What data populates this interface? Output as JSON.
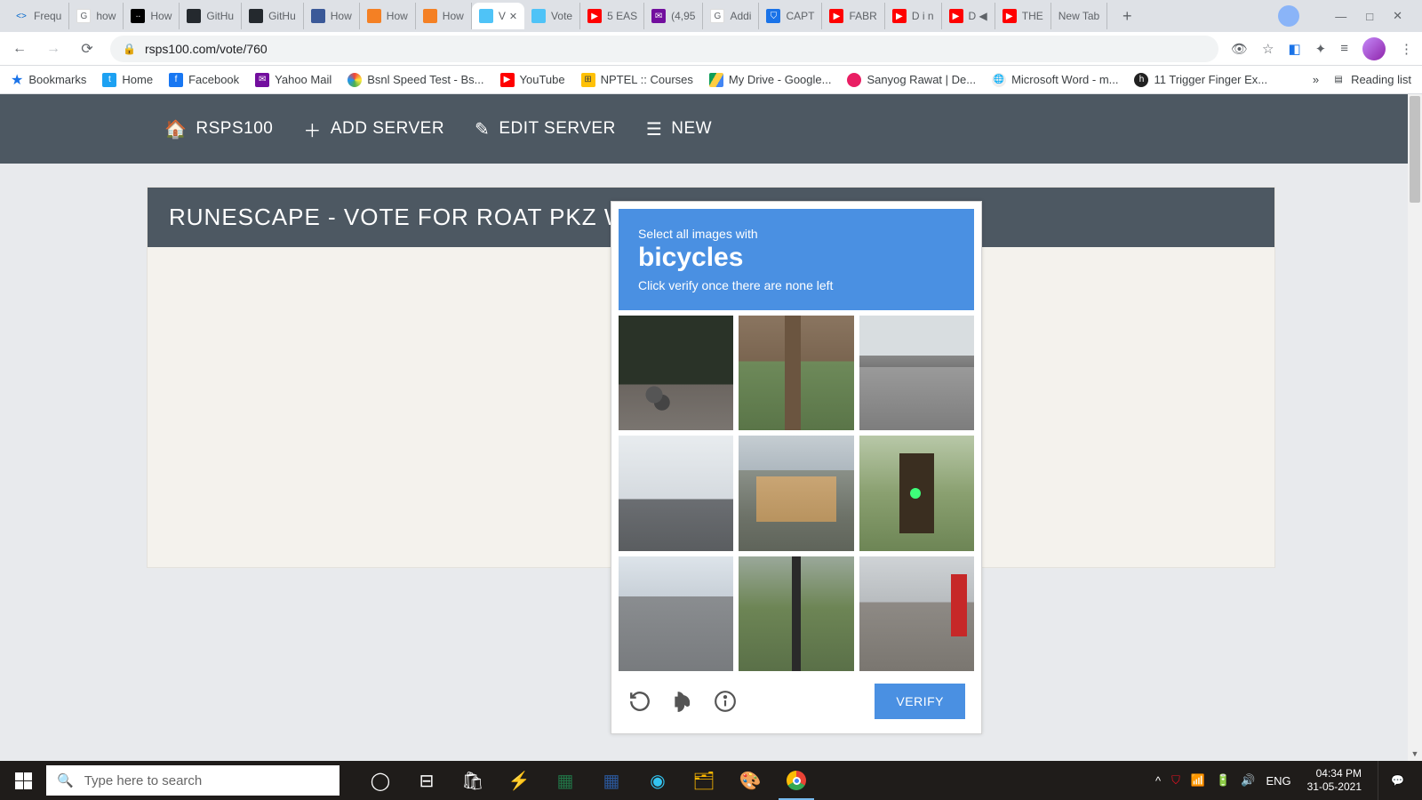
{
  "browser": {
    "tabs": [
      {
        "favicon": "code",
        "label": "Frequ"
      },
      {
        "favicon": "g",
        "label": "how"
      },
      {
        "favicon": "md",
        "label": "How"
      },
      {
        "favicon": "gh",
        "label": "GitHu"
      },
      {
        "favicon": "gh",
        "label": "GitHu"
      },
      {
        "favicon": "stk",
        "label": "How"
      },
      {
        "favicon": "so",
        "label": "How"
      },
      {
        "favicon": "so",
        "label": "How"
      },
      {
        "favicon": "cyan",
        "label": "V",
        "active": true
      },
      {
        "favicon": "cyan",
        "label": "Vote"
      },
      {
        "favicon": "yt",
        "label": "5 EAS"
      },
      {
        "favicon": "mail",
        "label": "(4,95"
      },
      {
        "favicon": "g",
        "label": "Addi"
      },
      {
        "favicon": "blue",
        "label": "CAPT"
      },
      {
        "favicon": "yt",
        "label": "FABR"
      },
      {
        "favicon": "yt",
        "label": "D i n"
      },
      {
        "favicon": "yt",
        "label": "D ◀"
      },
      {
        "favicon": "yt",
        "label": "THE"
      },
      {
        "favicon": "",
        "label": "New Tab"
      }
    ],
    "new_tab": "+",
    "win": {
      "min": "—",
      "max": "□",
      "close": "✕"
    },
    "nav": {
      "back": "←",
      "forward": "→",
      "reload": "⟳"
    },
    "url": "rsps100.com/vote/760",
    "addr_icons": {
      "incognito": "👁",
      "star": "☆",
      "ext1": "◧",
      "puzzle": "✦",
      "list": "≡",
      "menu": "⋮"
    },
    "bookmarks": [
      {
        "icon": "star",
        "label": "Bookmarks"
      },
      {
        "icon": "tw",
        "label": "Home"
      },
      {
        "icon": "fb",
        "label": "Facebook"
      },
      {
        "icon": "ym",
        "label": "Yahoo Mail"
      },
      {
        "icon": "bs",
        "label": "Bsnl Speed Test - Bs..."
      },
      {
        "icon": "yt",
        "label": "YouTube"
      },
      {
        "icon": "np",
        "label": "NPTEL :: Courses"
      },
      {
        "icon": "gd",
        "label": "My Drive - Google..."
      },
      {
        "icon": "sr",
        "label": "Sanyog Rawat | De..."
      },
      {
        "icon": "ms",
        "label": "Microsoft Word - m..."
      },
      {
        "icon": "tf",
        "label": "11 Trigger Finger Ex..."
      }
    ],
    "bm_overflow": "»",
    "reading_list": "Reading list"
  },
  "site": {
    "nav": [
      {
        "icon": "🏠",
        "label": "RSPS100"
      },
      {
        "icon": "＋",
        "label": "ADD SERVER"
      },
      {
        "icon": "✎",
        "label": "EDIT SERVER"
      },
      {
        "icon": "☰",
        "label": "NEW"
      }
    ],
    "page_title": "RUNESCAPE - VOTE FOR ROAT PKZ WILDY SKILLI"
  },
  "recaptcha": {
    "line1": "Select all images with",
    "target": "bicycles",
    "line3": "Click verify once there are none left",
    "verify": "VERIFY",
    "buttons": {
      "reload": "reload",
      "audio": "audio",
      "info": "info"
    }
  },
  "taskbar": {
    "search_placeholder": "Type here to search",
    "apps": [
      "cortana",
      "taskview",
      "store",
      "power",
      "excel",
      "word",
      "edge",
      "explorer",
      "paint",
      "chrome"
    ],
    "tray": {
      "up": "^",
      "defender": "⛨",
      "wifi": "📶",
      "battery": "▭",
      "volume": "🔊",
      "lang": "ENG"
    },
    "clock": {
      "time": "04:34 PM",
      "date": "31-05-2021"
    }
  }
}
